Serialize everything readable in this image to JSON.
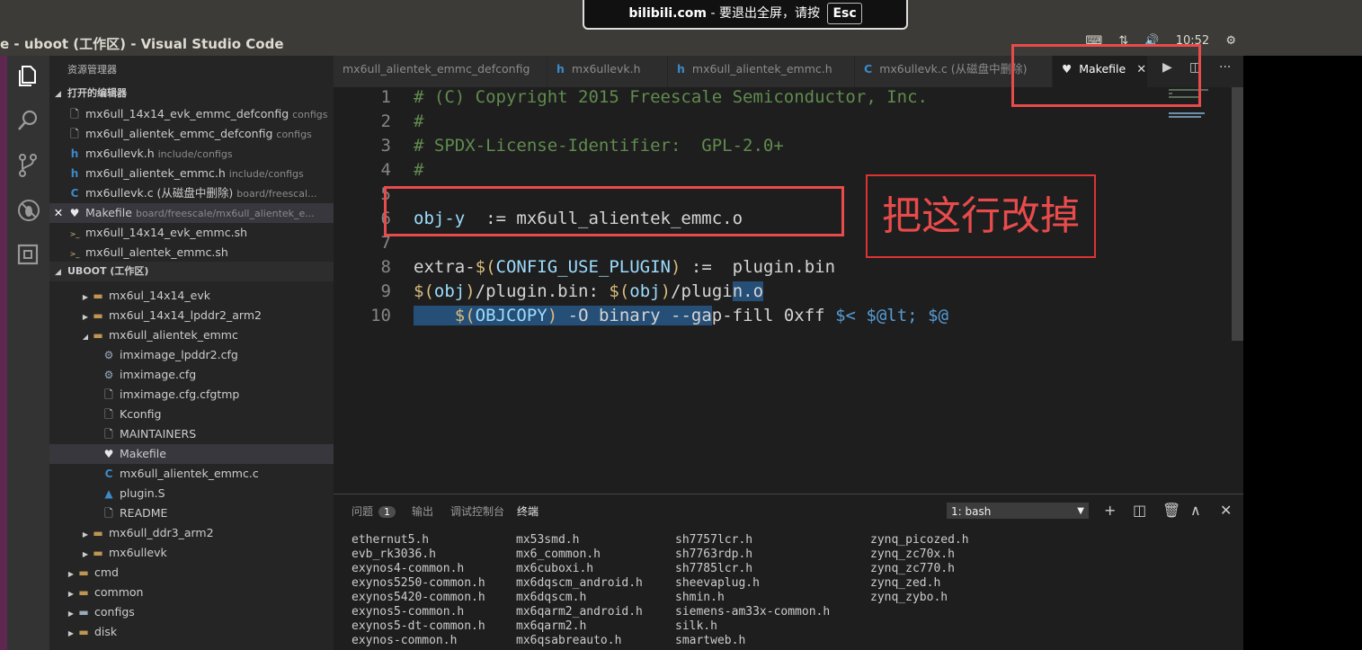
{
  "window": {
    "title": "e - uboot (工作区) - Visual Studio Code",
    "tray": [
      "⌨",
      "⇅",
      "🔊",
      "10:52",
      "⚙"
    ]
  },
  "notification": {
    "site": "bilibili.com",
    "message": "- 要退出全屏，请按",
    "key": "Esc"
  },
  "sidebar": {
    "title": "资源管理器",
    "open_editors_header": "打开的编辑器",
    "open_editors": [
      {
        "name": "mx6ull_14x14_evk_emmc_defconfig",
        "desc": "configs",
        "icon": "file-icon"
      },
      {
        "name": "mx6ull_alientek_emmc_defconfig",
        "desc": "configs",
        "icon": "file-icon"
      },
      {
        "name": "mx6ullevk.h",
        "desc": "include/configs",
        "icon": "h-file-icon"
      },
      {
        "name": "mx6ull_alientek_emmc.h",
        "desc": "include/configs",
        "icon": "h-file-icon"
      },
      {
        "name": "mx6ullevk.c (从磁盘中删除)",
        "desc": "board/freescal...",
        "icon": "c-file-icon"
      },
      {
        "name": "Makefile",
        "desc": "board/freescale/mx6ull_alientek_e...",
        "icon": "makefile-icon",
        "close": "✕"
      },
      {
        "name": "mx6ull_14x14_evk_emmc.sh",
        "desc": "",
        "icon": "shell-icon"
      },
      {
        "name": "mx6ull_alentek_emmc.sh",
        "desc": "",
        "icon": "shell-icon"
      }
    ],
    "workspace_header": "UBOOT (工作区)",
    "tree": [
      {
        "name": "mx6ul_14x14_evk",
        "type": "folder",
        "depth": 2,
        "twisty": "▶"
      },
      {
        "name": "mx6ul_14x14_lpddr2_arm2",
        "type": "folder",
        "depth": 2,
        "twisty": "▶"
      },
      {
        "name": "mx6ull_alientek_emmc",
        "type": "folder",
        "depth": 2,
        "twisty": "◢"
      },
      {
        "name": "imximage_lpddr2.cfg",
        "type": "gear",
        "depth": 3
      },
      {
        "name": "imximage.cfg",
        "type": "gear",
        "depth": 3
      },
      {
        "name": "imximage.cfg.cfgtmp",
        "type": "file",
        "depth": 3
      },
      {
        "name": "Kconfig",
        "type": "file",
        "depth": 3
      },
      {
        "name": "MAINTAINERS",
        "type": "file",
        "depth": 3
      },
      {
        "name": "Makefile",
        "type": "makefile",
        "depth": 3
      },
      {
        "name": "mx6ull_alientek_emmc.c",
        "type": "c",
        "depth": 3
      },
      {
        "name": "plugin.S",
        "type": "asm",
        "depth": 3
      },
      {
        "name": "README",
        "type": "file",
        "depth": 3
      },
      {
        "name": "mx6ull_ddr3_arm2",
        "type": "folder",
        "depth": 2,
        "twisty": "▶"
      },
      {
        "name": "mx6ullevk",
        "type": "folder",
        "depth": 2,
        "twisty": "▶"
      },
      {
        "name": "cmd",
        "type": "folder",
        "depth": 1,
        "twisty": "▶"
      },
      {
        "name": "common",
        "type": "folder",
        "depth": 1,
        "twisty": "▶"
      },
      {
        "name": "configs",
        "type": "folder-cfg",
        "depth": 1,
        "twisty": "▶"
      },
      {
        "name": "disk",
        "type": "folder",
        "depth": 1,
        "twisty": "▶"
      }
    ]
  },
  "tabs": [
    {
      "label": "mx6ull_alientek_emmc_defconfig",
      "icon": ""
    },
    {
      "label": "mx6ullevk.h",
      "icon": "h"
    },
    {
      "label": "mx6ull_alientek_emmc.h",
      "icon": "h"
    },
    {
      "label": "mx6ullevk.c (从磁盘中删除)",
      "icon": "C"
    },
    {
      "label": "Makefile",
      "icon": "♥",
      "close": "✕",
      "active": true
    }
  ],
  "editor": {
    "line_numbers": [
      "1",
      "2",
      "3",
      "4",
      "5",
      "6",
      "7",
      "8",
      "9",
      "10"
    ],
    "lines": [
      "# (C) Copyright 2015 Freescale Semiconductor, Inc.",
      "#",
      "# SPDX-License-Identifier:  GPL-2.0+",
      "#",
      "",
      "obj-y  := mx6ull_alientek_emmc.o",
      "",
      "extra-$(CONFIG_USE_PLUGIN) :=  plugin.bin",
      "$(obj)/plugin.bin: $(obj)/plugin.o",
      "    $(OBJCOPY) -O binary --gap-fill 0xff $< $@"
    ],
    "annotation": "把这行改掉"
  },
  "panel": {
    "tabs": [
      "问题",
      "输出",
      "调试控制台",
      "终端"
    ],
    "problems_count": "1",
    "terminal_select": "1: bash",
    "terminal_columns": [
      [
        "ethernut5.h",
        "evb_rk3036.h",
        "exynos4-common.h",
        "exynos5250-common.h",
        "exynos5420-common.h",
        "exynos5-common.h",
        "exynos5-dt-common.h",
        "exynos-common.h"
      ],
      [
        "mx53smd.h",
        "mx6_common.h",
        "mx6cuboxi.h",
        "mx6dqscm_android.h",
        "mx6dqscm.h",
        "mx6qarm2_android.h",
        "mx6qarm2.h",
        "mx6qsabreauto.h"
      ],
      [
        "sh7757lcr.h",
        "sh7763rdp.h",
        "sh7785lcr.h",
        "sheevaplug.h",
        "shmin.h",
        "siemens-am33x-common.h",
        "silk.h",
        "smartweb.h"
      ],
      [
        "zynq_picozed.h",
        "zynq_zc70x.h",
        "zynq_zc770.h",
        "zynq_zed.h",
        "zynq_zybo.h"
      ]
    ]
  }
}
